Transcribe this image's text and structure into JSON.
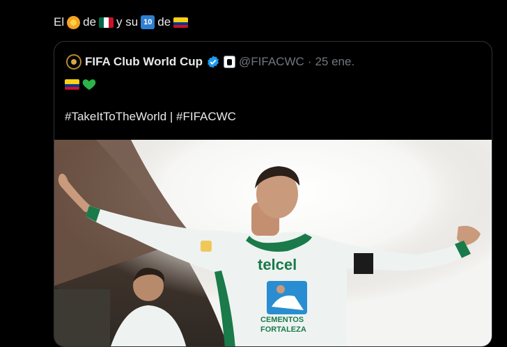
{
  "tweet": {
    "text_el": "El",
    "text_de1": "de",
    "text_ysu": "y su",
    "text_de2": "de",
    "ten_emoji": "10"
  },
  "quote": {
    "name": "FIFA Club World Cup",
    "handle": "@FIFACWC",
    "separator": "·",
    "date": "25 ene.",
    "hashtags": "#TakeItToTheWorld | #FIFACWC"
  },
  "media": {
    "jersey_sponsor": "telcel",
    "jersey_sponsor_2": "CEMENTOS",
    "jersey_sponsor_3": "FORTALEZA"
  },
  "colors": {
    "background": "#000000",
    "text": "#e7e9ea",
    "muted": "#71767b",
    "verified": "#1d9bf0",
    "border": "#2f3336",
    "jersey": "#eef3f1",
    "jersey_green": "#1a7a4a"
  },
  "icons": [
    "lion-emoji-icon",
    "mexico-flag-icon",
    "keycap-ten-icon",
    "colombia-flag-icon",
    "verified-badge-icon",
    "affiliate-badge-icon",
    "green-heart-icon"
  ]
}
